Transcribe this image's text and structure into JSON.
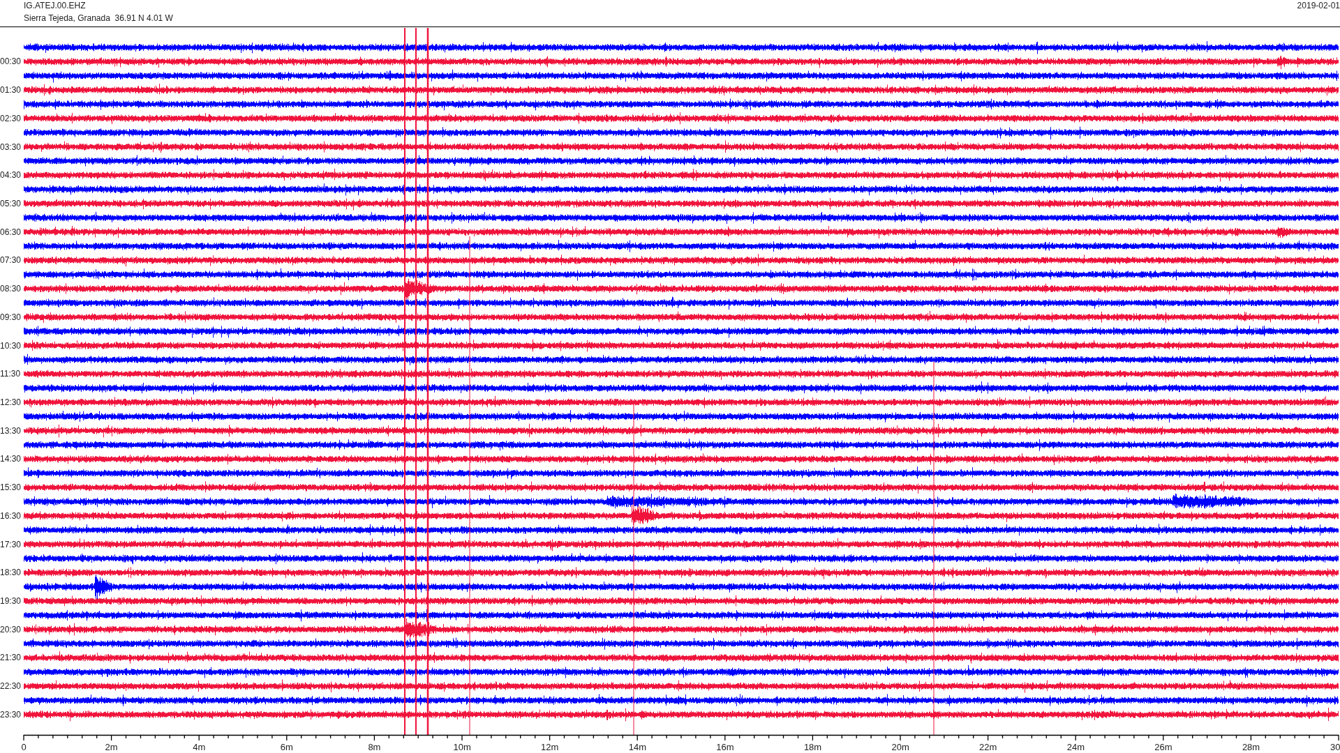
{
  "header": {
    "station": "IG.ATEJ.00.EHZ",
    "location": "Sierra Tejeda, Granada  36.91 N 4.01 W",
    "date": "2019-02-01"
  },
  "traces": [
    {
      "color": "#0000ff"
    },
    {
      "label": "00:30",
      "color": "#f0143c"
    },
    {
      "color": "#0000ff"
    },
    {
      "label": "01:30",
      "color": "#f0143c"
    },
    {
      "color": "#0000ff"
    },
    {
      "label": "02:30",
      "color": "#f0143c"
    },
    {
      "color": "#0000ff"
    },
    {
      "label": "03:30",
      "color": "#f0143c"
    },
    {
      "color": "#0000ff"
    },
    {
      "label": "04:30",
      "color": "#f0143c"
    },
    {
      "color": "#0000ff"
    },
    {
      "label": "05:30",
      "color": "#f0143c"
    },
    {
      "color": "#0000ff"
    },
    {
      "label": "06:30",
      "color": "#f0143c"
    },
    {
      "color": "#0000ff"
    },
    {
      "label": "07:30",
      "color": "#f0143c"
    },
    {
      "color": "#0000ff"
    },
    {
      "label": "08:30",
      "color": "#f0143c"
    },
    {
      "color": "#0000ff"
    },
    {
      "label": "09:30",
      "color": "#f0143c"
    },
    {
      "color": "#0000ff"
    },
    {
      "label": "10:30",
      "color": "#f0143c"
    },
    {
      "color": "#0000ff"
    },
    {
      "label": "11:30",
      "color": "#f0143c"
    },
    {
      "color": "#0000ff"
    },
    {
      "label": "12:30",
      "color": "#f0143c"
    },
    {
      "color": "#0000ff"
    },
    {
      "label": "13:30",
      "color": "#f0143c"
    },
    {
      "color": "#0000ff"
    },
    {
      "label": "14:30",
      "color": "#f0143c"
    },
    {
      "color": "#0000ff"
    },
    {
      "label": "15:30",
      "color": "#f0143c"
    },
    {
      "color": "#0000ff"
    },
    {
      "label": "16:30",
      "color": "#f0143c"
    },
    {
      "color": "#0000ff"
    },
    {
      "label": "17:30",
      "color": "#f0143c"
    },
    {
      "color": "#0000ff"
    },
    {
      "label": "18:30",
      "color": "#f0143c"
    },
    {
      "color": "#0000ff"
    },
    {
      "label": "19:30",
      "color": "#f0143c"
    },
    {
      "color": "#0000ff"
    },
    {
      "label": "20:30",
      "color": "#f0143c"
    },
    {
      "color": "#0000ff"
    },
    {
      "label": "21:30",
      "color": "#f0143c"
    },
    {
      "color": "#0000ff"
    },
    {
      "label": "22:30",
      "color": "#f0143c"
    },
    {
      "color": "#0000ff"
    },
    {
      "label": "23:30",
      "color": "#f0143c"
    }
  ],
  "x_axis": {
    "ticks": [
      "0",
      "2m",
      "4m",
      "6m",
      "8m",
      "10m",
      "12m",
      "14m",
      "16m",
      "18m",
      "20m",
      "22m",
      "24m",
      "26m",
      "28m",
      "30"
    ]
  }
}
